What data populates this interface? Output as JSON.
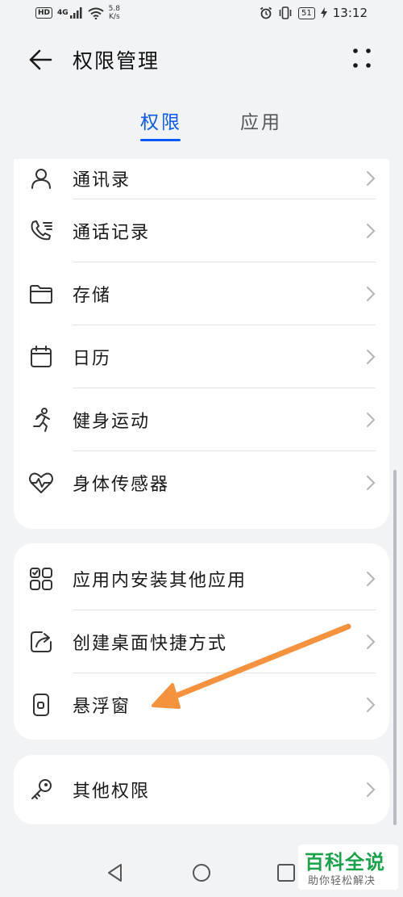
{
  "status_bar": {
    "hd_badge": "HD",
    "network": "4G",
    "speed_value": "5.8",
    "speed_unit": "K/s",
    "battery": "51",
    "time": "13:12"
  },
  "header": {
    "title": "权限管理"
  },
  "tabs": [
    {
      "label": "权限",
      "active": true
    },
    {
      "label": "应用",
      "active": false
    }
  ],
  "groups": [
    {
      "items": [
        {
          "label": "通讯录",
          "icon": "contacts-icon"
        },
        {
          "label": "通话记录",
          "icon": "call-log-icon"
        },
        {
          "label": "存储",
          "icon": "folder-icon"
        },
        {
          "label": "日历",
          "icon": "calendar-icon"
        },
        {
          "label": "健身运动",
          "icon": "running-icon"
        },
        {
          "label": "身体传感器",
          "icon": "heart-rate-icon"
        }
      ]
    },
    {
      "items": [
        {
          "label": "应用内安装其他应用",
          "icon": "app-grid-icon"
        },
        {
          "label": "创建桌面快捷方式",
          "icon": "shortcut-icon"
        },
        {
          "label": "悬浮窗",
          "icon": "floating-window-icon"
        }
      ]
    },
    {
      "items": [
        {
          "label": "其他权限",
          "icon": "key-icon"
        }
      ]
    }
  ],
  "colors": {
    "accent": "#0a59f7",
    "annotation_arrow": "#f5923e",
    "watermark_green": "#1aa34a"
  },
  "watermark": {
    "main": "百科全说",
    "sub": "助你轻松解决"
  }
}
